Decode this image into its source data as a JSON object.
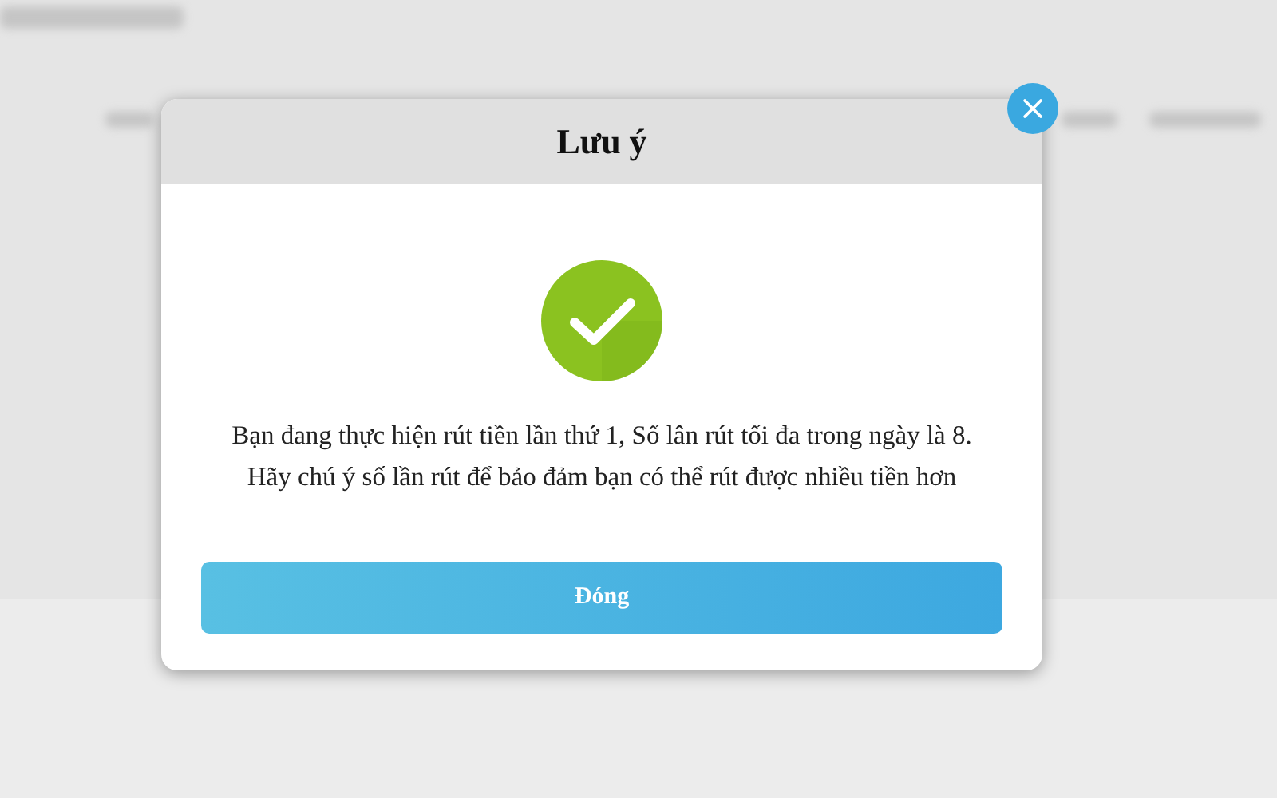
{
  "dialog": {
    "title": "Lưu ý",
    "icon": {
      "kind": "check"
    },
    "message_lines": [
      "Bạn đang thực hiện rút tiền lần thứ 1, Số lân rút tối đa trong ngày là 8.",
      "Hãy chú ý số lần rút để bảo đảm bạn có thể rút được nhiều tiền hơn"
    ],
    "buttons": [
      {
        "label": "Đóng"
      }
    ]
  }
}
